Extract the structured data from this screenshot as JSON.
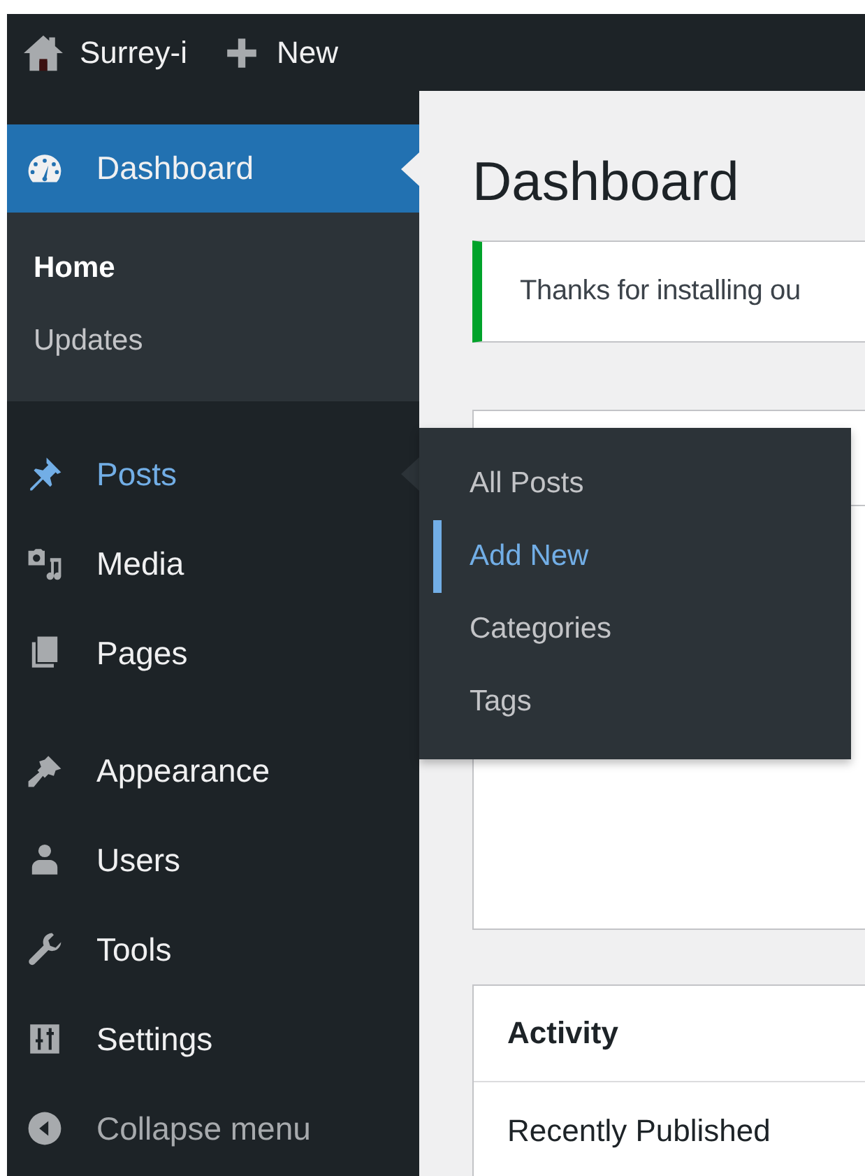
{
  "top_bar": {
    "site_name": "Surrey-i",
    "new_label": "New"
  },
  "sidebar": {
    "groups": [
      {
        "items": [
          {
            "label": "Dashboard",
            "kind": "gauge",
            "selected": true,
            "hovered": false,
            "submenu": [
              {
                "label": "Home",
                "selected": true
              },
              {
                "label": "Updates",
                "selected": false
              }
            ]
          }
        ]
      },
      {
        "items": [
          {
            "label": "Posts",
            "kind": "pin",
            "selected": false,
            "hovered": true
          },
          {
            "label": "Media",
            "kind": "media",
            "selected": false,
            "hovered": false
          },
          {
            "label": "Pages",
            "kind": "pages",
            "selected": false,
            "hovered": false
          }
        ]
      },
      {
        "items": [
          {
            "label": "Appearance",
            "kind": "brush",
            "selected": false,
            "hovered": false
          },
          {
            "label": "Users",
            "kind": "user",
            "selected": false,
            "hovered": false
          },
          {
            "label": "Tools",
            "kind": "wrench",
            "selected": false,
            "hovered": false
          },
          {
            "label": "Settings",
            "kind": "sliders",
            "selected": false,
            "hovered": false
          }
        ]
      }
    ],
    "collapse_label": "Collapse menu"
  },
  "flyout": {
    "items": [
      {
        "label": "All Posts",
        "selected": false
      },
      {
        "label": "Add New",
        "selected": true
      },
      {
        "label": "Categories",
        "selected": false
      },
      {
        "label": "Tags",
        "selected": false
      }
    ]
  },
  "page": {
    "title": "Dashboard",
    "notice": "Thanks for installing ou",
    "panels": [
      {
        "title": "Activity",
        "section": "Recently Published"
      }
    ]
  }
}
